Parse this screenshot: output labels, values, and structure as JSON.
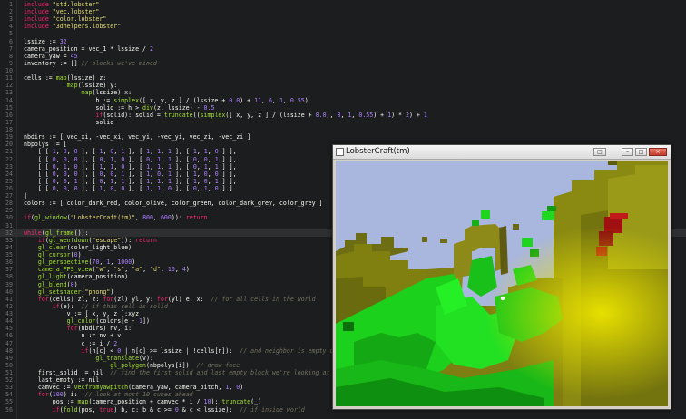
{
  "editor": {
    "lines": [
      {
        "n": "1",
        "html": "<span class='kw'>include</span> <span class='str'>\"std.lobster\"</span>"
      },
      {
        "n": "2",
        "html": "<span class='kw'>include</span> <span class='str'>\"vec.lobster\"</span>"
      },
      {
        "n": "3",
        "html": "<span class='kw'>include</span> <span class='str'>\"color.lobster\"</span>"
      },
      {
        "n": "4",
        "html": "<span class='kw'>include</span> <span class='str'>\"3dhelpers.lobster\"</span>"
      },
      {
        "n": "5",
        "html": ""
      },
      {
        "n": "6",
        "html": "lssize := <span class='num'>32</span>"
      },
      {
        "n": "7",
        "html": "camera_position = vec_1 * lssize / <span class='num'>2</span>"
      },
      {
        "n": "8",
        "html": "camera_yaw = <span class='num'>45</span>"
      },
      {
        "n": "9",
        "html": "inventory := [] <span class='cm'>// blocks we've mined</span>"
      },
      {
        "n": "10",
        "html": ""
      },
      {
        "n": "11",
        "html": "cells := <span class='fn'>map</span>(lssize) z:"
      },
      {
        "n": "12",
        "html": "            <span class='fn'>map</span>(lssize) y:"
      },
      {
        "n": "13",
        "html": "                <span class='fn'>map</span>(lssize) x:"
      },
      {
        "n": "14",
        "html": "                    h := <span class='fn'>simplex</span>([ x, y, z ] / (lssize + <span class='num'>0.0</span>) + <span class='num'>11</span>, <span class='num'>6</span>, <span class='num'>1</span>, <span class='num'>0.55</span>)"
      },
      {
        "n": "15",
        "html": "                    solid := h > <span class='fn'>div</span>(z, lssize) - <span class='num'>0.5</span>"
      },
      {
        "n": "16",
        "html": "                    <span class='kw'>if</span>(solid): solid = <span class='fn'>truncate</span>((<span class='fn'>simplex</span>([ x, y, z ] / (lssize + <span class='num'>0.0</span>), <span class='num'>8</span>, <span class='num'>1</span>, <span class='num'>0.55</span>) + <span class='num'>1</span>) * <span class='num'>2</span>) + <span class='num'>1</span>"
      },
      {
        "n": "17",
        "html": "                    solid"
      },
      {
        "n": "18",
        "html": ""
      },
      {
        "n": "19",
        "html": "nbdirs := [ vec_xi, -vec_xi, vec_yi, -vec_yi, vec_zi, -vec_zi ]"
      },
      {
        "n": "20",
        "html": "nbpolys := ["
      },
      {
        "n": "21",
        "html": "    [ [ <span class='num'>1</span>, <span class='num'>0</span>, <span class='num'>0</span> ], [ <span class='num'>1</span>, <span class='num'>0</span>, <span class='num'>1</span> ], [ <span class='num'>1</span>, <span class='num'>1</span>, <span class='num'>1</span> ], [ <span class='num'>1</span>, <span class='num'>1</span>, <span class='num'>0</span> ] ],"
      },
      {
        "n": "22",
        "html": "    [ [ <span class='num'>0</span>, <span class='num'>0</span>, <span class='num'>0</span> ], [ <span class='num'>0</span>, <span class='num'>1</span>, <span class='num'>0</span> ], [ <span class='num'>0</span>, <span class='num'>1</span>, <span class='num'>1</span> ], [ <span class='num'>0</span>, <span class='num'>0</span>, <span class='num'>1</span> ] ],"
      },
      {
        "n": "23",
        "html": "    [ [ <span class='num'>0</span>, <span class='num'>1</span>, <span class='num'>0</span> ], [ <span class='num'>1</span>, <span class='num'>1</span>, <span class='num'>0</span> ], [ <span class='num'>1</span>, <span class='num'>1</span>, <span class='num'>1</span> ], [ <span class='num'>0</span>, <span class='num'>1</span>, <span class='num'>1</span> ] ],"
      },
      {
        "n": "24",
        "html": "    [ [ <span class='num'>0</span>, <span class='num'>0</span>, <span class='num'>0</span> ], [ <span class='num'>0</span>, <span class='num'>0</span>, <span class='num'>1</span> ], [ <span class='num'>1</span>, <span class='num'>0</span>, <span class='num'>1</span> ], [ <span class='num'>1</span>, <span class='num'>0</span>, <span class='num'>0</span> ] ],"
      },
      {
        "n": "25",
        "html": "    [ [ <span class='num'>0</span>, <span class='num'>0</span>, <span class='num'>1</span> ], [ <span class='num'>0</span>, <span class='num'>1</span>, <span class='num'>1</span> ], [ <span class='num'>1</span>, <span class='num'>1</span>, <span class='num'>1</span> ], [ <span class='num'>1</span>, <span class='num'>0</span>, <span class='num'>1</span> ] ],"
      },
      {
        "n": "26",
        "html": "    [ [ <span class='num'>0</span>, <span class='num'>0</span>, <span class='num'>0</span> ], [ <span class='num'>1</span>, <span class='num'>0</span>, <span class='num'>0</span> ], [ <span class='num'>1</span>, <span class='num'>1</span>, <span class='num'>0</span> ], [ <span class='num'>0</span>, <span class='num'>1</span>, <span class='num'>0</span> ] ]"
      },
      {
        "n": "27",
        "html": "]"
      },
      {
        "n": "28",
        "html": "colors := [ color_dark_red, color_olive, color_green, color_dark_grey, color_grey ]"
      },
      {
        "n": "29",
        "html": ""
      },
      {
        "n": "30",
        "html": "<span class='kw'>if</span>(<span class='fn'>gl_window</span>(<span class='str'>\"LobsterCraft(tm)\"</span>, <span class='num'>800</span>, <span class='num'>600</span>)): <span class='kw'>return</span>"
      },
      {
        "n": "31",
        "html": ""
      },
      {
        "n": "32",
        "html": "<span class='kw'>while</span>(<span class='fn'>gl_frame</span>()):"
      },
      {
        "n": "33",
        "html": "    <span class='kw'>if</span>(<span class='fn'>gl_wentdown</span>(<span class='str'>\"escape\"</span>)): <span class='kw'>return</span>"
      },
      {
        "n": "34",
        "html": "    <span class='fn'>gl_clear</span>(color_light_blue)"
      },
      {
        "n": "35",
        "html": "    <span class='fn'>gl_cursor</span>(<span class='num'>0</span>)"
      },
      {
        "n": "36",
        "html": "    <span class='fn'>gl_perspective</span>(<span class='num'>70</span>, <span class='num'>1</span>, <span class='num'>1000</span>)"
      },
      {
        "n": "37",
        "html": "    <span class='fn'>camera_FPS_view</span>(<span class='str'>\"w\"</span>, <span class='str'>\"s\"</span>, <span class='str'>\"a\"</span>, <span class='str'>\"d\"</span>, <span class='num'>10</span>, <span class='num'>4</span>)"
      },
      {
        "n": "38",
        "html": "    <span class='fn'>gl_light</span>(camera_position)"
      },
      {
        "n": "39",
        "html": "    <span class='fn'>gl_blend</span>(<span class='num'>0</span>)"
      },
      {
        "n": "40",
        "html": "    <span class='fn'>gl_setshader</span>(<span class='str'>\"phong\"</span>)"
      },
      {
        "n": "41",
        "html": "    <span class='kw'>for</span>(cells) zl, z: <span class='kw'>for</span>(zl) yl, y: <span class='kw'>for</span>(yl) e, x:  <span class='cm'>// for all cells in the world</span>"
      },
      {
        "n": "42",
        "html": "        <span class='kw'>if</span>(e):  <span class='cm'>// if this cell is solid</span>"
      },
      {
        "n": "43",
        "html": "            v := [ x, y, z ]:xyz"
      },
      {
        "n": "44",
        "html": "            <span class='fn'>gl_color</span>(colors[e - <span class='num'>1</span>])"
      },
      {
        "n": "45",
        "html": "            <span class='kw'>for</span>(nbdirs) nv, i:"
      },
      {
        "n": "46",
        "html": "                n := nv + v"
      },
      {
        "n": "47",
        "html": "                c := i / <span class='num'>2</span>"
      },
      {
        "n": "48",
        "html": "                <span class='kw'>if</span>(n[c] < <span class='num'>0</span> | n[c] >= lssize | !cells[n]):  <span class='cm'>// and neighbor is empty or outside</span>"
      },
      {
        "n": "49",
        "html": "                    <span class='fn'>gl_translate</span>(v):"
      },
      {
        "n": "50",
        "html": "                        <span class='fn'>gl_polygon</span>(nbpolys[i])  <span class='cm'>// draw face</span>"
      },
      {
        "n": "51",
        "html": "    first_solid := nil  <span class='cm'>// find the first solid and last empty block we're looking at</span>"
      },
      {
        "n": "52",
        "html": "    last_empty := nil"
      },
      {
        "n": "53",
        "html": "    camvec := <span class='fn'>vecfromyawpitch</span>(camera_yaw, camera_pitch, <span class='num'>1</span>, <span class='num'>0</span>)"
      },
      {
        "n": "54",
        "html": "    <span class='kw'>for</span>(<span class='num'>100</span>) i:  <span class='cm'>// look at most 10 cubes ahead</span>"
      },
      {
        "n": "55",
        "html": "        pos := <span class='fn'>map</span>(camera_position + camvec * i / <span class='num'>10</span>): <span class='fn'>truncate</span>(_)"
      },
      {
        "n": "56",
        "html": "        <span class='kw'>if</span>(<span class='fn'>fold</span>(pos, <span class='kw'>true</span>) b, c: b & c >= <span class='num'>0</span> & c < lssize):  <span class='cm'>// if inside world</span>"
      }
    ],
    "current_line": "32"
  },
  "window": {
    "title": "LobsterCraft(tm)",
    "btn_restore": "□",
    "btn_min": "–",
    "btn_max": "□",
    "btn_close": "×"
  },
  "colors": {
    "bg": "#1b1d1e",
    "sky": "#a9b6dd",
    "olive": "#7a7a10",
    "green": "#19d01a",
    "dark_red": "#9a1010"
  }
}
